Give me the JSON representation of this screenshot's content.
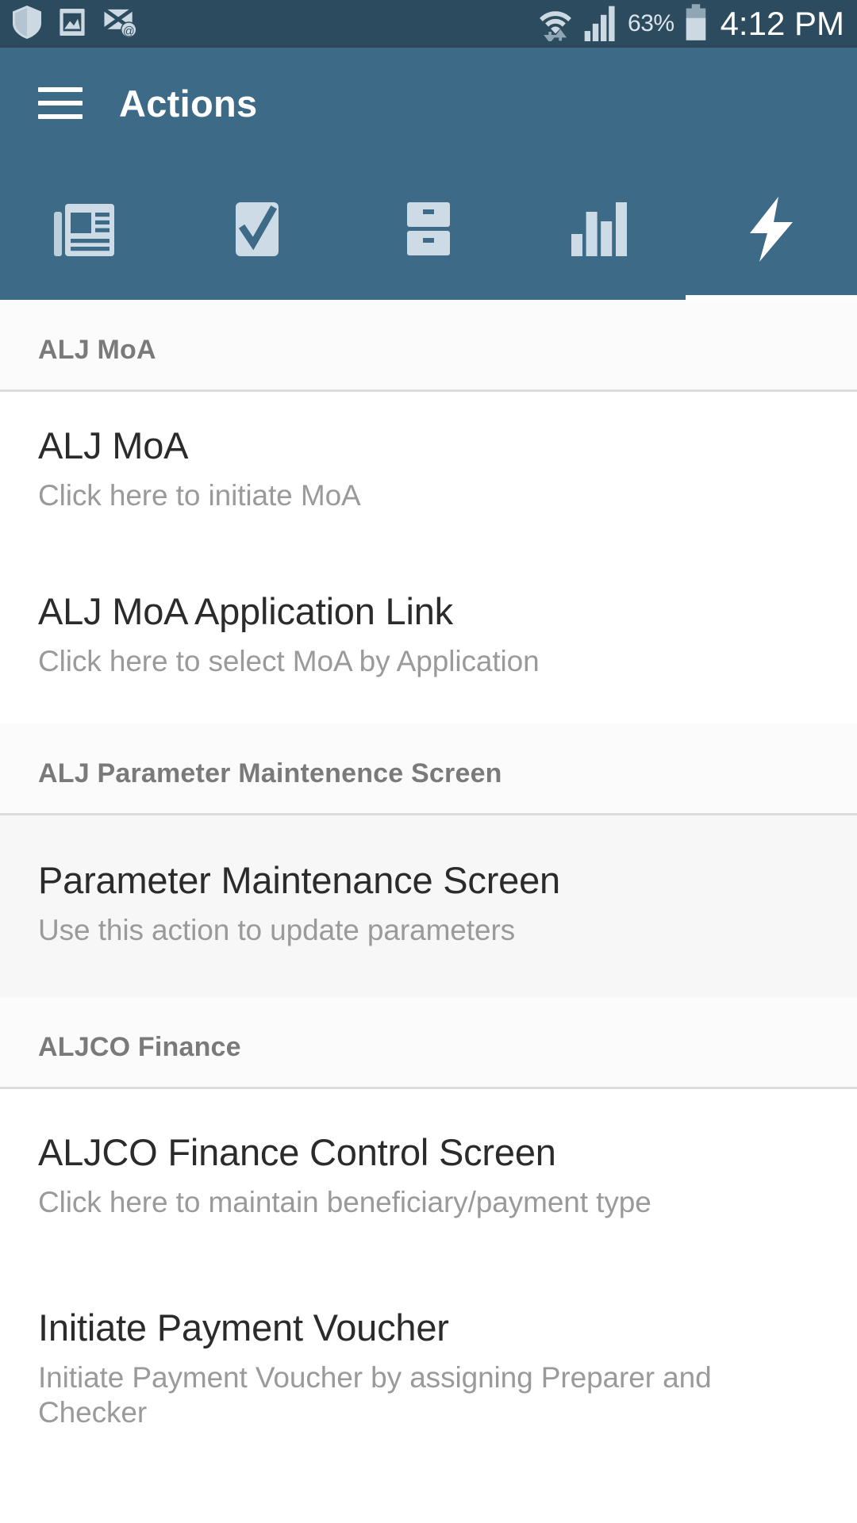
{
  "status_bar": {
    "icons_left": [
      "shield-icon",
      "photo-icon",
      "email-at-icon"
    ],
    "wifi_icon": "wifi-transfer-icon",
    "signal_icon": "cell-signal-icon",
    "battery_percent": "63%",
    "battery_icon": "battery-icon",
    "clock": "4:12 PM"
  },
  "app_bar": {
    "menu_icon": "hamburger-menu-icon",
    "title": "Actions",
    "tabs": [
      {
        "icon": "news-icon",
        "active": false
      },
      {
        "icon": "checkmark-icon",
        "active": false
      },
      {
        "icon": "filing-cabinet-icon",
        "active": false
      },
      {
        "icon": "bar-chart-icon",
        "active": false
      },
      {
        "icon": "lightning-bolt-icon",
        "active": true
      }
    ]
  },
  "colors": {
    "status_bar": "#2d4b5e",
    "app_bar": "#3d6a87",
    "accent": "#ffffff",
    "section_header_text": "#7a7a7a",
    "item_title_text": "#2b2b2b",
    "item_sub_text": "#9a9a9a"
  },
  "list": [
    {
      "type": "section",
      "label": "ALJ MoA"
    },
    {
      "type": "item",
      "title": "ALJ MoA",
      "subtitle": "Click here to initiate MoA",
      "pressed": false
    },
    {
      "type": "item",
      "title": "ALJ MoA Application Link",
      "subtitle": "Click here to select MoA by Application",
      "pressed": false
    },
    {
      "type": "section",
      "label": "ALJ Parameter Maintenence Screen"
    },
    {
      "type": "item",
      "title": "Parameter Maintenance Screen",
      "subtitle": "Use this action to update parameters",
      "pressed": true
    },
    {
      "type": "section",
      "label": "ALJCO Finance"
    },
    {
      "type": "item",
      "title": "ALJCO Finance Control Screen",
      "subtitle": "Click here to maintain beneficiary/payment type",
      "pressed": false
    },
    {
      "type": "item",
      "title": "Initiate Payment Voucher",
      "subtitle": "Initiate Payment Voucher by assigning Preparer and Checker",
      "pressed": false
    }
  ]
}
